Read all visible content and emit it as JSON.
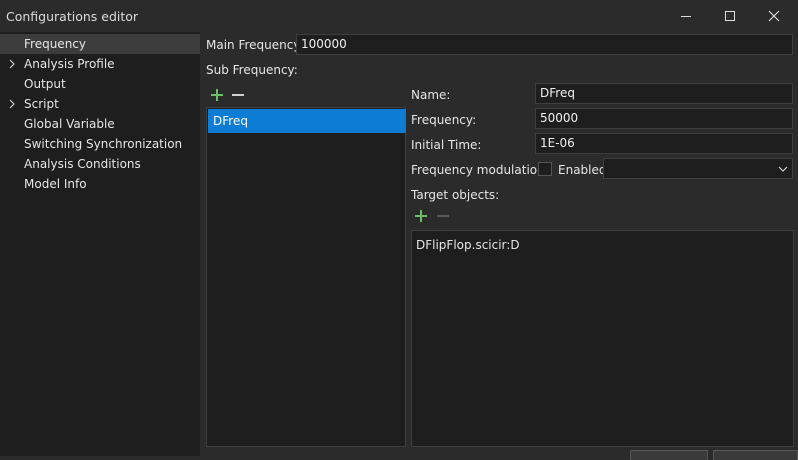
{
  "window": {
    "title": "Configurations editor",
    "controls": [
      "minimize-icon",
      "maximize-icon",
      "close-icon"
    ]
  },
  "sidebar": {
    "items": [
      {
        "label": "Frequency",
        "expandable": false,
        "selected": true
      },
      {
        "label": "Analysis Profile",
        "expandable": true,
        "selected": false
      },
      {
        "label": "Output",
        "expandable": false,
        "selected": false
      },
      {
        "label": "Script",
        "expandable": true,
        "selected": false
      },
      {
        "label": "Global Variable",
        "expandable": false,
        "selected": false
      },
      {
        "label": "Switching Synchronization",
        "expandable": false,
        "selected": false
      },
      {
        "label": "Analysis Conditions",
        "expandable": false,
        "selected": false
      },
      {
        "label": "Model Info",
        "expandable": false,
        "selected": false
      }
    ]
  },
  "main_frequency": {
    "label": "Main Frequency:",
    "value": "100000"
  },
  "sub_frequency": {
    "label": "Sub Frequency:",
    "items": [
      "DFreq"
    ],
    "selected": "DFreq"
  },
  "details": {
    "name_label": "Name:",
    "name_value": "DFreq",
    "frequency_label": "Frequency:",
    "frequency_value": "50000",
    "initial_time_label": "Initial Time:",
    "initial_time_value": "1E-06",
    "modulation_label": "Frequency modulation:",
    "enabled_label": "Enabled",
    "enabled_checked": false,
    "modulation_select_value": "",
    "target_label": "Target objects:",
    "targets": [
      "DFlipFlop.scicir:D"
    ]
  },
  "colors": {
    "accent": "#0c7cd5",
    "add_icon": "#6abf69",
    "background": "#2b2b2b",
    "panel": "#1e1e1e"
  }
}
